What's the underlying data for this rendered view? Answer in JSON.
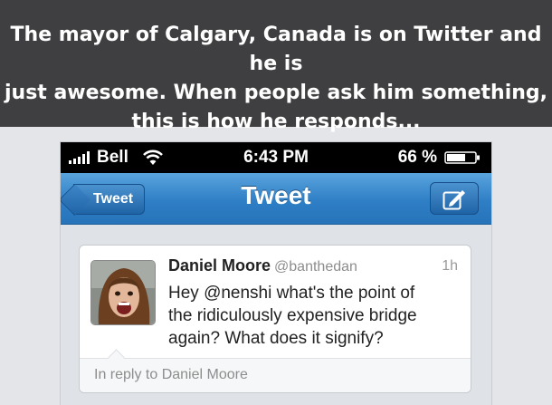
{
  "banner": {
    "lines": [
      "The mayor of Calgary, Canada is on Twitter and he is",
      "just awesome. When people ask him something,",
      "this is how he responds..."
    ]
  },
  "status_bar": {
    "carrier": "Bell",
    "time": "6:43 PM",
    "battery": "66 %",
    "icons": [
      "signal-bars-icon",
      "wifi-icon",
      "battery-icon"
    ]
  },
  "nav": {
    "back_label": "Tweet",
    "title": "Tweet",
    "compose_icon": "compose-icon"
  },
  "tweet": {
    "author_name": "Daniel Moore",
    "author_handle": "@banthedan",
    "time": "1h",
    "text_lines": [
      "Hey @nenshi what's the point of",
      "the ridiculously expensive bridge",
      "again? What does it signify?"
    ],
    "reply_label": "In reply to Daniel Moore"
  },
  "colors": {
    "banner_bg": "#3f3f41",
    "nav_blue": "#2f7fc6",
    "page_bg": "#e3e5e9"
  }
}
